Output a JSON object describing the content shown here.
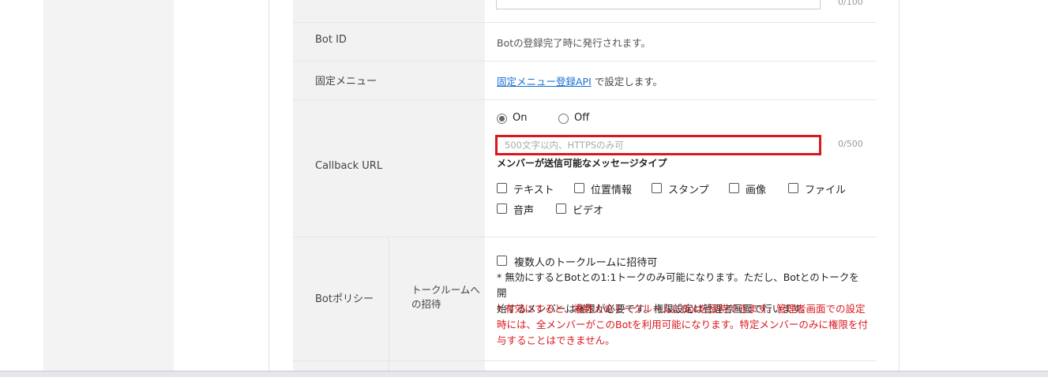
{
  "top_field": {
    "counter": "0/100"
  },
  "bot_id": {
    "label": "Bot ID",
    "value": "Botの登録完了時に発行されます。"
  },
  "fixed_menu": {
    "label": "固定メニュー",
    "link_text": "固定メニュー登録API",
    "suffix": " で設定します。"
  },
  "callback": {
    "label": "Callback URL",
    "radio_on": "On",
    "radio_off": "Off",
    "url_placeholder": "500文字以内、HTTPSのみ可",
    "url_value": "",
    "counter": "0/500",
    "message_types_title": "メンバーが送信可能なメッセージタイプ",
    "message_types": [
      "テキスト",
      "位置情報",
      "スタンプ",
      "画像",
      "ファイル",
      "音声",
      "ビデオ"
    ]
  },
  "bot_policy": {
    "label": "Botポリシー",
    "sub_label_line1": "トークルームへ",
    "sub_label_line2": "の招待",
    "checkbox_label": "複数人のトークルームに招待可",
    "note_line1": "* 無効にするとBotとの1:1トークのみ可能になります。ただし、Botとのトークを開",
    "note_line2": "始するメンバーは権限が必要です。権限設定は管理者画面で行います。",
    "red_line1": "* 有効にすると、複数人のトークルームにBotを招待できます。管理者画面での設定",
    "red_line2": "時には、全メンバーがこのBotを利用可能になります。特定メンバーのみに権限を付",
    "red_line3": "与することはできません。"
  },
  "colors": {
    "highlight": "#d9181e",
    "link": "#1a6fd1",
    "label_bg": "#f2f2f2"
  }
}
